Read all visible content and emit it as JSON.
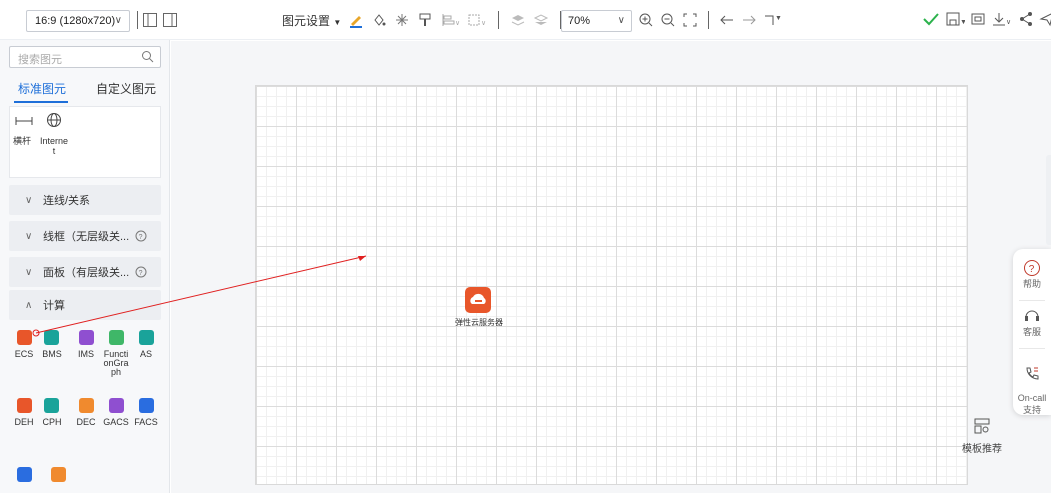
{
  "toolbar": {
    "canvas_size": "16:9 (1280x720)",
    "element_settings_label": "图元设置",
    "zoom_value": "70%"
  },
  "left_panel": {
    "search_placeholder": "搜索图元",
    "tabs": [
      {
        "label": "标准图元",
        "active": true
      },
      {
        "label": "自定义图元",
        "active": false
      }
    ],
    "standard_items": [
      {
        "label": "横杆",
        "icon": "bar-icon"
      },
      {
        "label": "Interne\nt",
        "icon": "globe-icon"
      }
    ],
    "categories": [
      {
        "label": "连线/关系",
        "expanded": false,
        "help": false
      },
      {
        "label": "线框（无层级关...",
        "expanded": false,
        "help": true
      },
      {
        "label": "面板（有层级关...",
        "expanded": false,
        "help": true
      },
      {
        "label": "计算",
        "expanded": true,
        "help": false
      }
    ],
    "compute_items": [
      {
        "label": "ECS",
        "color": "#e8562a"
      },
      {
        "label": "BMS",
        "color": "#1aa39a"
      },
      {
        "label": "IMS",
        "color": "#8f4fd0"
      },
      {
        "label": "Functi\nonGra\nph",
        "color": "#3fb768"
      },
      {
        "label": "AS",
        "color": "#1aa39a"
      },
      {
        "label": "DEH",
        "color": "#e8562a"
      },
      {
        "label": "CPH",
        "color": "#1aa39a"
      },
      {
        "label": "DEC",
        "color": "#f08a2e"
      },
      {
        "label": "GACS",
        "color": "#8f4fd0"
      },
      {
        "label": "FACS",
        "color": "#2a6de0"
      },
      {
        "label": "",
        "color": "#2a6de0"
      },
      {
        "label": "",
        "color": "#f08a2e"
      }
    ]
  },
  "canvas": {
    "node_label": "弹性云服务器",
    "node_color": "#e8562a",
    "connector_color": "#e02020",
    "template_label": "模板推荐"
  },
  "help_panel": {
    "help_label": "帮助",
    "service_label": "客服",
    "oncall_label": "On-call\n支持"
  },
  "colors": {
    "accent": "#1e6fd9",
    "check": "#2bb24c"
  }
}
